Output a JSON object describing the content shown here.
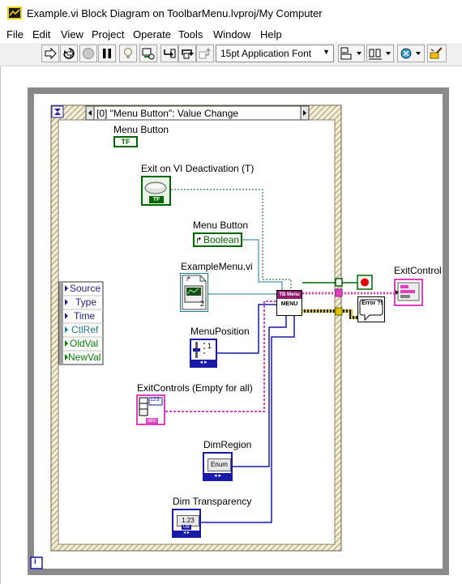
{
  "window": {
    "title": "Example.vi Block Diagram on ToolbarMenu.lvproj/My Computer"
  },
  "menubar": {
    "items": [
      "File",
      "Edit",
      "View",
      "Project",
      "Operate",
      "Tools",
      "Window",
      "Help"
    ]
  },
  "toolbar": {
    "font_label": "15pt Application Font"
  },
  "event_structure": {
    "selector_label": "[0] \"Menu Button\": Value Change"
  },
  "event_data_node": {
    "items": [
      "Source",
      "Type",
      "Time",
      "CtlRef",
      "OldVal",
      "NewVal"
    ]
  },
  "nodes": {
    "menu_button_terminal": {
      "label": "Menu Button",
      "glyph": "TF"
    },
    "exit_on_deactivation": {
      "label": "Exit on VI Deactivation (T)",
      "glyph": "TF"
    },
    "menu_button_ref": {
      "label": "Menu Button",
      "value": "Boolean"
    },
    "example_menu_vi": {
      "label": "ExampleMenu.vi",
      "index": "2"
    },
    "menu_position": {
      "label": "MenuPosition",
      "glyph": "1"
    },
    "exit_controls": {
      "label": "ExitControls (Empty for all)",
      "glyph": "123",
      "sub": "abc"
    },
    "dim_region": {
      "label": "DimRegion",
      "glyph": "Enum"
    },
    "dim_transparency": {
      "label": "Dim Transparency",
      "glyph": "1.23",
      "sub": "U8"
    },
    "tb_menu_subvi": {
      "header": "TB Menu",
      "body": "MENU"
    },
    "exit_control": {
      "label": "ExitControl"
    },
    "error_handler": {
      "glyph": "Error ?!"
    }
  },
  "loop": {
    "info_glyph": "i"
  },
  "colors": {
    "boolean_wire": "#006600",
    "numeric_wire": "#1a1aa8",
    "string_wire": "#e040c0",
    "ref_wire": "#207a90",
    "error_wire": "#b8a000",
    "loop_frame": "#8a8a8a"
  }
}
